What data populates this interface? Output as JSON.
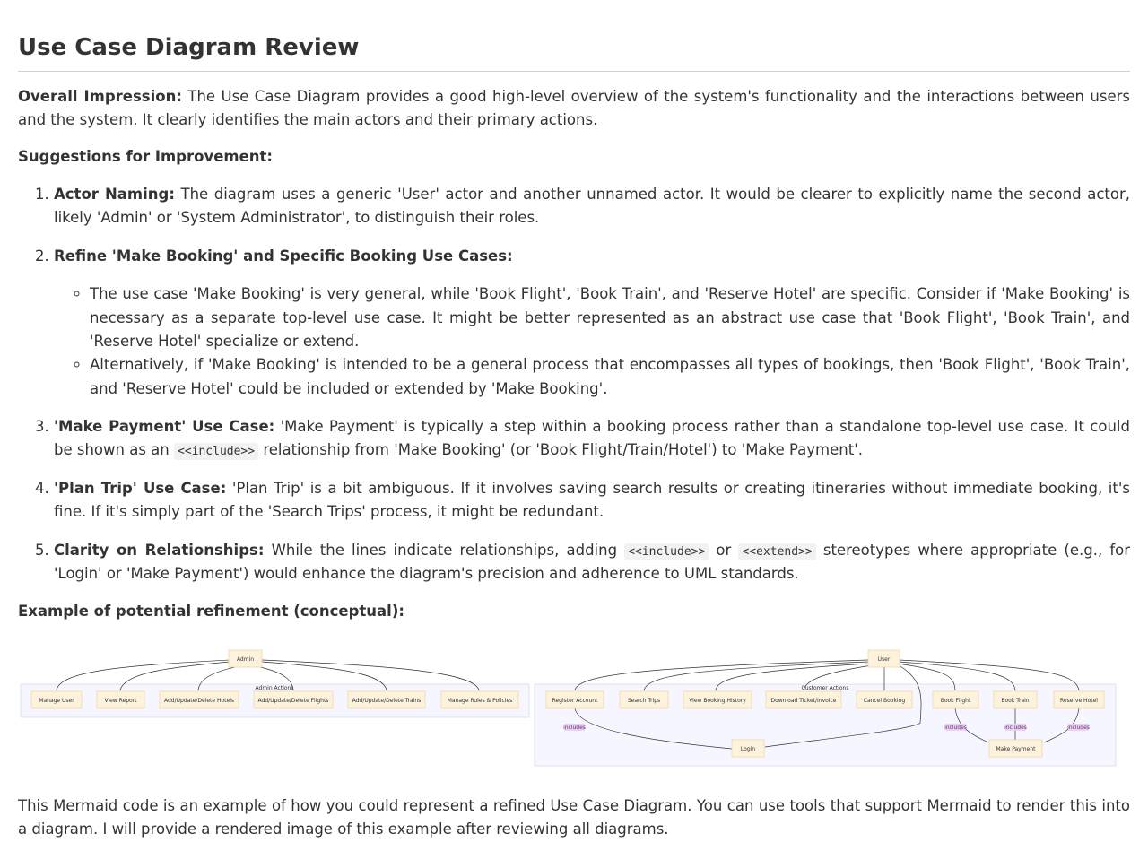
{
  "title": "Use Case Diagram Review",
  "overall": {
    "label": "Overall Impression:",
    "text": " The Use Case Diagram provides a good high-level overview of the system's functionality and the interactions between users and the system. It clearly identifies the main actors and their primary actions."
  },
  "suggestions_heading": "Suggestions for Improvement:",
  "items": [
    {
      "label": "Actor Naming:",
      "text": " The diagram uses a generic 'User' actor and another unnamed actor. It would be clearer to explicitly name the second actor, likely 'Admin' or 'System Administrator', to distinguish their roles."
    },
    {
      "label": "Refine 'Make Booking' and Specific Booking Use Cases:",
      "sub": [
        "The use case 'Make Booking' is very general, while 'Book Flight', 'Book Train', and 'Reserve Hotel' are specific. Consider if 'Make Booking' is necessary as a separate top-level use case. It might be better represented as an abstract use case that 'Book Flight', 'Book Train', and 'Reserve Hotel' specialize or extend.",
        "Alternatively, if 'Make Booking' is intended to be a general process that encompasses all types of bookings, then 'Book Flight', 'Book Train', and 'Reserve Hotel' could be included or extended by 'Make Booking'."
      ]
    },
    {
      "label": "'Make Payment' Use Case:",
      "text_a": " 'Make Payment' is typically a step within a booking process rather than a standalone top-level use case. It could be shown as an ",
      "code": "<<include>>",
      "text_b": " relationship from 'Make Booking' (or 'Book Flight/Train/Hotel') to 'Make Payment'."
    },
    {
      "label": "'Plan Trip' Use Case:",
      "text": " 'Plan Trip' is a bit ambiguous. If it involves saving search results or creating itineraries without immediate booking, it's fine. If it's simply part of the 'Search Trips' process, it might be redundant."
    },
    {
      "label": "Clarity on Relationships:",
      "text_a": " While the lines indicate relationships, adding ",
      "code1": "<<include>>",
      "text_mid": " or ",
      "code2": "<<extend>>",
      "text_b": " stereotypes where appropriate (e.g., for 'Login' or 'Make Payment') would enhance the diagram's precision and adherence to UML standards."
    }
  ],
  "example_heading": "Example of potential refinement (conceptual):",
  "diagram_admin": {
    "actor": "Admin",
    "group": "Admin Actions",
    "nodes": [
      "Manage User",
      "View Report",
      "Add/Update/Delete Hotels",
      "Add/Update/Delete Flights",
      "Add/Update/Delete Trains",
      "Manage Rules & Policies"
    ]
  },
  "diagram_user": {
    "actor": "User",
    "group": "Customer Actions",
    "nodes": [
      "Register Account",
      "Search Trips",
      "View Booking History",
      "Download Ticket/Invoice",
      "Cancel Booking",
      "Book Flight",
      "Book Train",
      "Reserve Hotel"
    ],
    "login": "Login",
    "payment": "Make Payment",
    "includes_label": "includes"
  },
  "footer_text": "This Mermaid code is an example of how you could represent a refined Use Case Diagram. You can use tools that support Mermaid to render this into a diagram. I will provide a rendered image of this example after reviewing all diagrams."
}
